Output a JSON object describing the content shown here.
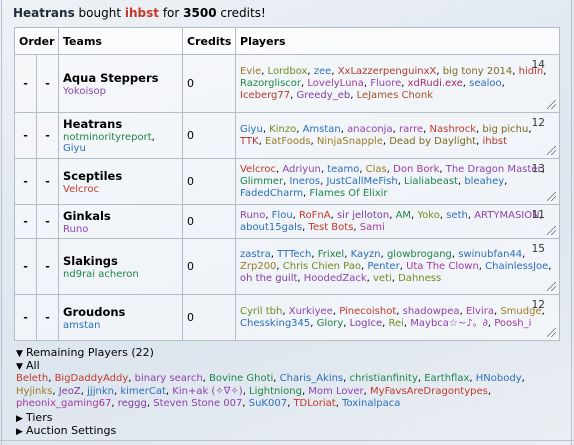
{
  "message": {
    "buyer": "Heatrans",
    "verb": "bought",
    "player": "ihbst",
    "for": "for",
    "amount": "3500",
    "suffix": "credits!"
  },
  "table": {
    "headers": {
      "order": "Order",
      "teams": "Teams",
      "credits": "Credits",
      "players": "Players"
    },
    "rows": [
      {
        "dash1": "-",
        "dash2": "-",
        "name": "Aqua Steppers",
        "managers": [
          {
            "t": "Yokoisop",
            "c": "#8e44ad"
          }
        ],
        "credits": "0",
        "count": "14",
        "players": [
          {
            "t": "Evie",
            "c": "#9a7b25"
          },
          {
            "t": "Lordbox",
            "c": "#6f8b1f"
          },
          {
            "t": "zee",
            "c": "#2c6fb7"
          },
          {
            "t": "XxLazzerpenguinxX",
            "c": "#b03a2e"
          },
          {
            "t": "big tony 2014",
            "c": "#7d6a1f"
          },
          {
            "t": "hidin",
            "c": "#c0392b"
          },
          {
            "t": "Razorgliscor",
            "c": "#1e8449"
          },
          {
            "t": "LovelyLuna",
            "c": "#a03ca0"
          },
          {
            "t": "Fluore",
            "c": "#8e44ad"
          },
          {
            "t": "xdRudi.exe",
            "c": "#a02c6a"
          },
          {
            "t": "sealoo",
            "c": "#2c6fb7"
          },
          {
            "t": "Iceberg77",
            "c": "#b03a2e"
          },
          {
            "t": "Greedy_eb",
            "c": "#7d3ca0"
          },
          {
            "t": "LeJames Chonk",
            "c": "#a0522d"
          }
        ]
      },
      {
        "dash1": "-",
        "dash2": "-",
        "name": "Heatrans",
        "managers": [
          {
            "t": "notminorityreport",
            "c": "#1e8449"
          },
          {
            "t": "Giyu",
            "c": "#2c6fb7"
          }
        ],
        "credits": "0",
        "count": "12",
        "players": [
          {
            "t": "Giyu",
            "c": "#2c6fb7"
          },
          {
            "t": "Kinzo",
            "c": "#6f8b1f"
          },
          {
            "t": "Amstan",
            "c": "#2c6fb7"
          },
          {
            "t": "anaconja",
            "c": "#8e44ad"
          },
          {
            "t": "rarre",
            "c": "#a03ca0"
          },
          {
            "t": "Nashrock",
            "c": "#c0392b"
          },
          {
            "t": "big pichu",
            "c": "#7d6a1f"
          },
          {
            "t": "TTK",
            "c": "#b03a2e"
          },
          {
            "t": "EatFoods",
            "c": "#9a7b25"
          },
          {
            "t": "NinjaSnapple",
            "c": "#9a7b25"
          },
          {
            "t": "Dead by Daylight",
            "c": "#7d6a1f"
          },
          {
            "t": "ihbst",
            "c": "#b03a2e"
          }
        ]
      },
      {
        "dash1": "-",
        "dash2": "-",
        "name": "Sceptiles",
        "managers": [
          {
            "t": "Velcroc",
            "c": "#c0392b"
          }
        ],
        "credits": "0",
        "count": "13",
        "players": [
          {
            "t": "Velcroc",
            "c": "#c0392b"
          },
          {
            "t": "Adriyun",
            "c": "#8e44ad"
          },
          {
            "t": "teamo",
            "c": "#2c6fb7"
          },
          {
            "t": "Clas",
            "c": "#9a7b25"
          },
          {
            "t": "Don Bork",
            "c": "#a03ca0"
          },
          {
            "t": "The Dragon Master",
            "c": "#8e44ad"
          },
          {
            "t": "Glimmer",
            "c": "#1e8449"
          },
          {
            "t": "Ineros",
            "c": "#2c6fb7"
          },
          {
            "t": "JustCallMeFish",
            "c": "#2c6fb7"
          },
          {
            "t": "Lialiabeast",
            "c": "#1e8449"
          },
          {
            "t": "bleahey",
            "c": "#2c6fb7"
          },
          {
            "t": "FadedCharm",
            "c": "#2c6fb7"
          },
          {
            "t": "Flames Of Elixir",
            "c": "#1e8449"
          }
        ]
      },
      {
        "dash1": "-",
        "dash2": "-",
        "name": "Ginkals",
        "managers": [
          {
            "t": "Runo",
            "c": "#8e44ad"
          }
        ],
        "credits": "0",
        "count": "11",
        "players": [
          {
            "t": "Runo",
            "c": "#8e44ad"
          },
          {
            "t": "Flou",
            "c": "#2c6fb7"
          },
          {
            "t": "RoFnA",
            "c": "#c0392b"
          },
          {
            "t": "sir jelloton",
            "c": "#7d3ca0"
          },
          {
            "t": "AM",
            "c": "#1e8449"
          },
          {
            "t": "Yoko",
            "c": "#6f8b1f"
          },
          {
            "t": "seth",
            "c": "#2c6fb7"
          },
          {
            "t": "ARTYMASION",
            "c": "#8e44ad"
          },
          {
            "t": "about15gals",
            "c": "#2c6fb7"
          },
          {
            "t": "Test Bots",
            "c": "#c0392b"
          },
          {
            "t": "Sami",
            "c": "#a03ca0"
          }
        ]
      },
      {
        "dash1": "-",
        "dash2": "-",
        "name": "Slakings",
        "managers": [
          {
            "t": "nd9rai acheron",
            "c": "#1e8449"
          }
        ],
        "credits": "0",
        "count": "15",
        "players": [
          {
            "t": "zastra",
            "c": "#2c6fb7"
          },
          {
            "t": "TTTech",
            "c": "#2c6fb7"
          },
          {
            "t": "Frixel",
            "c": "#1e8449"
          },
          {
            "t": "Kayzn",
            "c": "#2c6fb7"
          },
          {
            "t": "glowbrogang",
            "c": "#1e8449"
          },
          {
            "t": "swinubfan44",
            "c": "#2c6fb7"
          },
          {
            "t": "Zrp200",
            "c": "#9a7b25"
          },
          {
            "t": "Chris Chien Pao",
            "c": "#6f8b1f"
          },
          {
            "t": "Penter",
            "c": "#2c6fb7"
          },
          {
            "t": "Uta The Clown",
            "c": "#a03ca0"
          },
          {
            "t": "ChainlessJoe",
            "c": "#2c6fb7"
          },
          {
            "t": "oh the guilt",
            "c": "#7d3ca0"
          },
          {
            "t": "HoodedZack",
            "c": "#8e44ad"
          },
          {
            "t": "veti",
            "c": "#6f8b1f"
          },
          {
            "t": "Dahness",
            "c": "#6f8b1f"
          }
        ]
      },
      {
        "dash1": "-",
        "dash2": "-",
        "name": "Groudons",
        "managers": [
          {
            "t": "amstan",
            "c": "#2c6fb7"
          }
        ],
        "credits": "0",
        "count": "12",
        "players": [
          {
            "t": "Cyril tbh",
            "c": "#6f8b1f"
          },
          {
            "t": "Xurkiyee",
            "c": "#8e44ad"
          },
          {
            "t": "Pinecoishot",
            "c": "#c0392b"
          },
          {
            "t": "shadowpea",
            "c": "#8e44ad"
          },
          {
            "t": "Elvira",
            "c": "#a03ca0"
          },
          {
            "t": "Smudge",
            "c": "#9a7b25"
          },
          {
            "t": "Chessking345",
            "c": "#2c6fb7"
          },
          {
            "t": "Glory",
            "c": "#1e8449"
          },
          {
            "t": "LogIce",
            "c": "#7d3ca0"
          },
          {
            "t": "Rei",
            "c": "#6f8b1f"
          },
          {
            "t": "Maybca☆~♪。∂",
            "c": "#8e44ad"
          },
          {
            "t": "Poosh_i",
            "c": "#a03ca0"
          }
        ]
      }
    ]
  },
  "sections": {
    "remaining": "Remaining Players (22)",
    "all": "All",
    "tiers": "Tiers",
    "settings": "Auction Settings"
  },
  "remaining_players": [
    {
      "t": "Beleth",
      "c": "#c0392b"
    },
    {
      "t": "BigDaddyAddy",
      "c": "#c0392b"
    },
    {
      "t": "binary search",
      "c": "#8e44ad"
    },
    {
      "t": "Bovine Ghoti",
      "c": "#1e8449"
    },
    {
      "t": "Charis_Akins",
      "c": "#2c6fb7"
    },
    {
      "t": "christianfinity",
      "c": "#1e8449"
    },
    {
      "t": "Earthflax",
      "c": "#1e8449"
    },
    {
      "t": "HNobody",
      "c": "#2c6fb7"
    },
    {
      "t": "Hyjinks",
      "c": "#9a7b25"
    },
    {
      "t": "JeoZ",
      "c": "#7d3ca0"
    },
    {
      "t": "jjjnkn",
      "c": "#2c6fb7"
    },
    {
      "t": "kimerCat",
      "c": "#2c6fb7"
    },
    {
      "t": "Kin+ak (✧∇✧)",
      "c": "#8e44ad"
    },
    {
      "t": "Lightniong",
      "c": "#1e8449"
    },
    {
      "t": "Mom Lover",
      "c": "#8e44ad"
    },
    {
      "t": "MyFavsAreDragontypes",
      "c": "#c0392b"
    },
    {
      "t": "pheonix_gaming67",
      "c": "#a03ca0"
    },
    {
      "t": "reggg",
      "c": "#7d3ca0"
    },
    {
      "t": "Steven Stone 007",
      "c": "#8e44ad"
    },
    {
      "t": "SuK007",
      "c": "#2c6fb7"
    },
    {
      "t": "TDLoriat",
      "c": "#c0392b"
    },
    {
      "t": "Toxinalpaca",
      "c": "#2c6fb7"
    }
  ]
}
